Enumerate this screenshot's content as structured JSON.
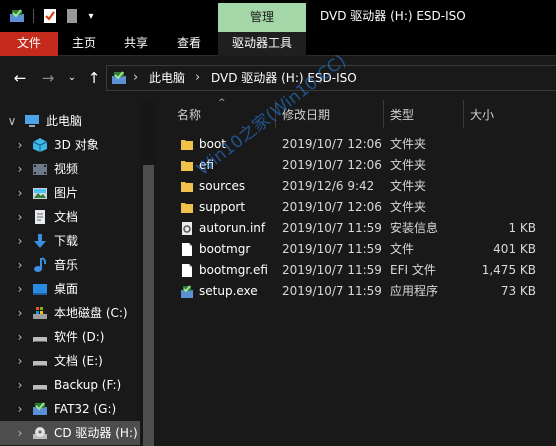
{
  "window": {
    "title": "DVD 驱动器 (H:) ESD-ISO",
    "context_tab": "管理"
  },
  "ribbon": {
    "tabs": [
      "文件",
      "主页",
      "共享",
      "查看",
      "驱动器工具"
    ]
  },
  "address": {
    "segments": [
      "此电脑",
      "DVD 驱动器 (H:) ESD-ISO"
    ]
  },
  "sidebar": {
    "items": [
      {
        "label": "此电脑",
        "icon": "pc-icon",
        "expander": "expanded"
      },
      {
        "label": "3D 对象",
        "icon": "3d-objects-icon",
        "expander": "collapsed"
      },
      {
        "label": "视频",
        "icon": "video-icon",
        "expander": "collapsed"
      },
      {
        "label": "图片",
        "icon": "pictures-icon",
        "expander": "collapsed"
      },
      {
        "label": "文档",
        "icon": "documents-icon",
        "expander": "collapsed"
      },
      {
        "label": "下载",
        "icon": "download-icon",
        "expander": "collapsed"
      },
      {
        "label": "音乐",
        "icon": "music-icon",
        "expander": "collapsed"
      },
      {
        "label": "桌面",
        "icon": "desktop-icon",
        "expander": "collapsed"
      },
      {
        "label": "本地磁盘 (C:)",
        "icon": "system-drive-icon",
        "expander": "collapsed"
      },
      {
        "label": "软件 (D:)",
        "icon": "drive-icon",
        "expander": "collapsed"
      },
      {
        "label": "文档 (E:)",
        "icon": "drive-icon",
        "expander": "collapsed"
      },
      {
        "label": "Backup (F:)",
        "icon": "drive-icon",
        "expander": "collapsed"
      },
      {
        "label": "FAT32 (G:)",
        "icon": "usb-drive-icon",
        "expander": "collapsed"
      },
      {
        "label": "CD 驱动器 (H:)",
        "icon": "cd-drive-icon",
        "expander": "collapsed",
        "selected": true
      }
    ]
  },
  "columns": {
    "name": "名称",
    "date": "修改日期",
    "type": "类型",
    "size": "大小"
  },
  "files": [
    {
      "name": "boot",
      "date": "2019/10/7 12:06",
      "type": "文件夹",
      "size": "",
      "icon": "folder-icon"
    },
    {
      "name": "efi",
      "date": "2019/10/7 12:06",
      "type": "文件夹",
      "size": "",
      "icon": "folder-icon"
    },
    {
      "name": "sources",
      "date": "2019/12/6 9:42",
      "type": "文件夹",
      "size": "",
      "icon": "folder-icon"
    },
    {
      "name": "support",
      "date": "2019/10/7 12:06",
      "type": "文件夹",
      "size": "",
      "icon": "folder-icon"
    },
    {
      "name": "autorun.inf",
      "date": "2019/10/7 11:59",
      "type": "安装信息",
      "size": "1 KB",
      "icon": "setup-info-icon"
    },
    {
      "name": "bootmgr",
      "date": "2019/10/7 11:59",
      "type": "文件",
      "size": "401 KB",
      "icon": "file-icon"
    },
    {
      "name": "bootmgr.efi",
      "date": "2019/10/7 11:59",
      "type": "EFI 文件",
      "size": "1,475 KB",
      "icon": "file-icon"
    },
    {
      "name": "setup.exe",
      "date": "2019/10/7 11:59",
      "type": "应用程序",
      "size": "73 KB",
      "icon": "setup-exe-icon"
    }
  ],
  "watermark": "Win10之家(Win10.CC)",
  "colors": {
    "file_tab": "#c42b1c",
    "context_tab": "#a5d6a7",
    "folder": "#f0c24b",
    "selection": "#4d4d4d"
  }
}
